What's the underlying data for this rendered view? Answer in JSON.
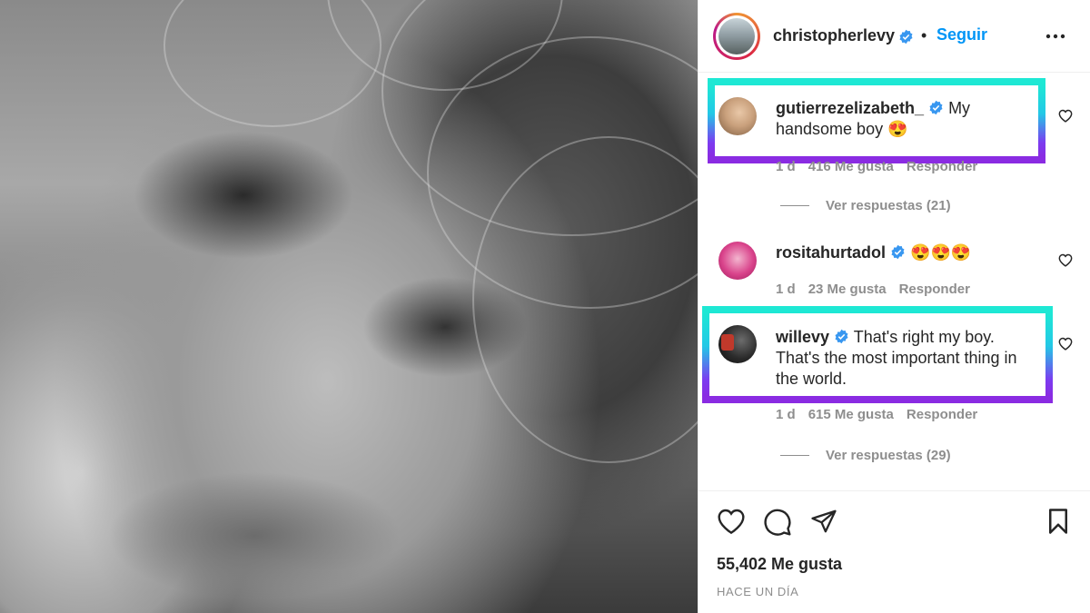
{
  "post": {
    "author": "christopherlevy",
    "follow_label": "Seguir",
    "separator": "•",
    "likes": "55,402 Me gusta",
    "timestamp": "HACE UN DÍA"
  },
  "comments": [
    {
      "username": "gutierrezelizabeth_",
      "text": "My handsome boy 😍",
      "age": "1 d",
      "likes": "416 Me gusta",
      "reply_label": "Responder",
      "view_replies": "Ver respuestas (21)",
      "highlighted": true
    },
    {
      "username": "rositahurtadol",
      "text": "😍😍😍",
      "age": "1 d",
      "likes": "23 Me gusta",
      "reply_label": "Responder",
      "highlighted": false
    },
    {
      "username": "willevy",
      "text": "That's right my boy. That's the most important thing in the world.",
      "age": "1 d",
      "likes": "615 Me gusta",
      "reply_label": "Responder",
      "view_replies": "Ver respuestas (29)",
      "highlighted": true
    }
  ],
  "icons": {
    "verified": "verified-badge-icon",
    "more": "more-options-icon",
    "like": "heart-icon",
    "comment": "comment-icon",
    "share": "send-icon",
    "save": "bookmark-icon"
  },
  "colors": {
    "verified": "#3897f0",
    "link": "#0095f6",
    "muted": "#8e8e8e",
    "highlight_top": "#1ee8d4",
    "highlight_bottom": "#8a2be2"
  }
}
